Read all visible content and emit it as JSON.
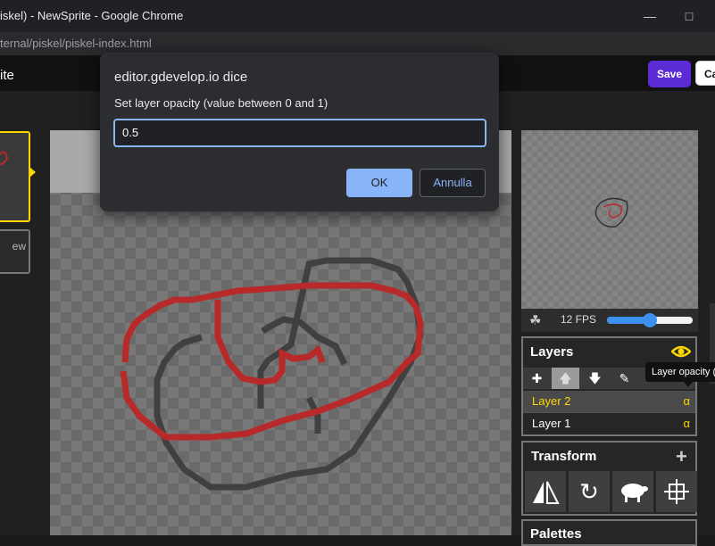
{
  "browser": {
    "window_title": "iskel) - NewSprite - Google Chrome",
    "url": "ternal/piskel/piskel-index.html"
  },
  "app": {
    "name": "ite",
    "save_label": "Save",
    "cancel_label": "Ca"
  },
  "frames": {
    "new_frame_label": "ew"
  },
  "animation": {
    "fps_label": "12 FPS",
    "fps_level": 0.5
  },
  "layers": {
    "title": "Layers",
    "tooltip": "Layer opacity (",
    "items": [
      {
        "name": "Layer 2",
        "alpha_glyph": "α",
        "selected": true
      },
      {
        "name": "Layer 1",
        "alpha_glyph": "α",
        "selected": false
      }
    ]
  },
  "transform": {
    "title": "Transform"
  },
  "palettes": {
    "title": "Palettes"
  },
  "dialog": {
    "title": "editor.gdevelop.io dice",
    "message": "Set layer opacity (value between 0 and 1)",
    "input_value": "0.5",
    "ok_label": "OK",
    "cancel_label": "Annulla"
  },
  "colors": {
    "accent_save": "#5b2bd6",
    "selection_yellow": "#ffd700",
    "dialog_blue": "#8ab4f8",
    "sprite_red": "#b82a2a"
  }
}
